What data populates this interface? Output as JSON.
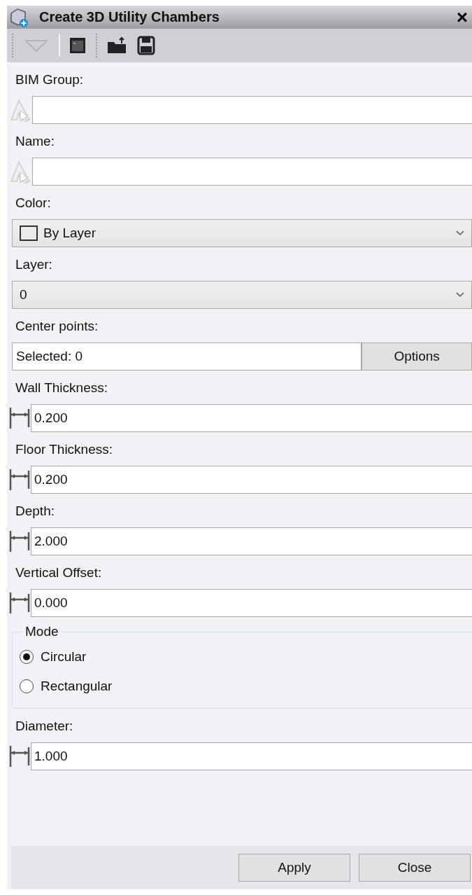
{
  "window": {
    "title": "Create 3D Utility Chambers",
    "close": "×"
  },
  "fields": [
    {
      "kind": "text",
      "label": "BIM Group:"
    },
    {
      "kind": "text",
      "label": "Name:"
    },
    {
      "kind": "color",
      "label": "Color:",
      "value": "By Layer"
    },
    {
      "kind": "dropdown",
      "label": "Layer:",
      "value": "0"
    },
    {
      "kind": "selection",
      "label": "Center points:",
      "value": "Selected: 0",
      "button": "Options"
    },
    {
      "kind": "distance",
      "label": "Wall Thickness:",
      "value": "0.200"
    },
    {
      "kind": "distance",
      "label": "Floor Thickness:",
      "value": "0.200"
    },
    {
      "kind": "distance",
      "label": "Depth:",
      "value": "2.000"
    },
    {
      "kind": "distance",
      "label": "Vertical Offset:",
      "value": "0.000"
    },
    {
      "kind": "radio",
      "label": "Mode",
      "options": [
        {
          "label": "Circular",
          "selected": true
        },
        {
          "label": "Rectangular",
          "selected": false
        }
      ]
    },
    {
      "kind": "distance",
      "label": "Diameter:",
      "value": "1.000"
    }
  ],
  "buttons": [
    "Apply",
    "Close"
  ]
}
